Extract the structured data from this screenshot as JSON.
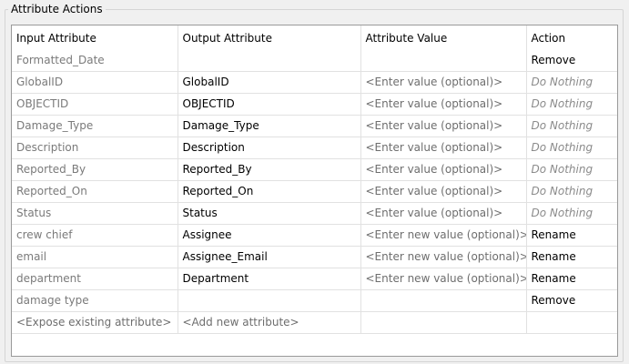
{
  "group_title": "Attribute Actions",
  "columns": [
    "Input Attribute",
    "Output Attribute",
    "Attribute Value",
    "Action"
  ],
  "rows": [
    {
      "input": "Formatted_Date",
      "output": "",
      "value": "",
      "action": "Remove",
      "action_style": "dark",
      "value_style": "placeholder"
    },
    {
      "input": "GlobalID",
      "output": "GlobalID",
      "value": "<Enter value (optional)>",
      "action": "Do Nothing",
      "action_style": "italic",
      "value_style": "placeholder"
    },
    {
      "input": "OBJECTID",
      "output": "OBJECTID",
      "value": "<Enter value (optional)>",
      "action": "Do Nothing",
      "action_style": "italic",
      "value_style": "placeholder"
    },
    {
      "input": "Damage_Type",
      "output": "Damage_Type",
      "value": "<Enter value (optional)>",
      "action": "Do Nothing",
      "action_style": "italic",
      "value_style": "placeholder"
    },
    {
      "input": "Description",
      "output": "Description",
      "value": "<Enter value (optional)>",
      "action": "Do Nothing",
      "action_style": "italic",
      "value_style": "placeholder"
    },
    {
      "input": "Reported_By",
      "output": "Reported_By",
      "value": "<Enter value (optional)>",
      "action": "Do Nothing",
      "action_style": "italic",
      "value_style": "placeholder"
    },
    {
      "input": "Reported_On",
      "output": "Reported_On",
      "value": "<Enter value (optional)>",
      "action": "Do Nothing",
      "action_style": "italic",
      "value_style": "placeholder"
    },
    {
      "input": "Status",
      "output": "Status",
      "value": "<Enter value (optional)>",
      "action": "Do Nothing",
      "action_style": "italic",
      "value_style": "placeholder"
    },
    {
      "input": "crew chief",
      "output": "Assignee",
      "value": "<Enter new value (optional)>",
      "action": "Rename",
      "action_style": "dark",
      "value_style": "placeholder"
    },
    {
      "input": "email",
      "output": "Assignee_Email",
      "value": "<Enter new value (optional)>",
      "action": "Rename",
      "action_style": "dark",
      "value_style": "placeholder"
    },
    {
      "input": "department",
      "output": "Department",
      "value": "<Enter new value (optional)>",
      "action": "Rename",
      "action_style": "dark",
      "value_style": "placeholder"
    },
    {
      "input": "damage type",
      "output": "",
      "value": "",
      "action": "Remove",
      "action_style": "dark",
      "value_style": "placeholder"
    },
    {
      "input": "<Expose existing attribute>",
      "output": "<Add new attribute>",
      "value": "",
      "action": "",
      "action_style": "dark",
      "value_style": "placeholder"
    }
  ]
}
